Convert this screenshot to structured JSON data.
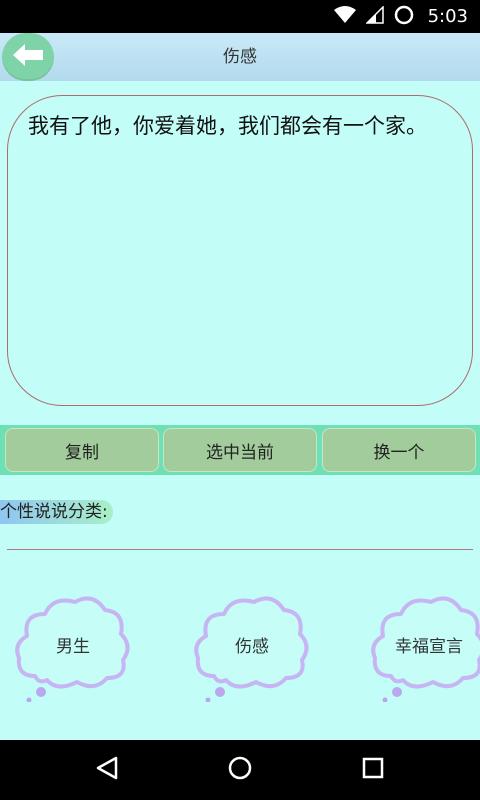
{
  "status_bar": {
    "time": "5:03",
    "icons": [
      "wifi-icon",
      "signal-icon",
      "alarm-icon"
    ]
  },
  "app_bar": {
    "title": "伤感",
    "back_icon": "back-arrow-icon"
  },
  "quote": {
    "text": "我有了他，你爱着她，我们都会有一个家。"
  },
  "actions": {
    "copy": "复制",
    "select_current": "选中当前",
    "next": "换一个"
  },
  "category_section": {
    "label": "个性说说分类:",
    "items": [
      "男生",
      "伤感",
      "幸福宣言"
    ]
  },
  "nav_bar": {
    "icons": [
      "back-triangle-icon",
      "home-circle-icon",
      "recents-square-icon"
    ]
  },
  "colors": {
    "background": "#c2fdf8",
    "action_bar": "#6fe0b6",
    "action_button": "#a2cc9c",
    "back_button": "#7fd3a9",
    "cloud_stroke": "#c7b5f3"
  }
}
